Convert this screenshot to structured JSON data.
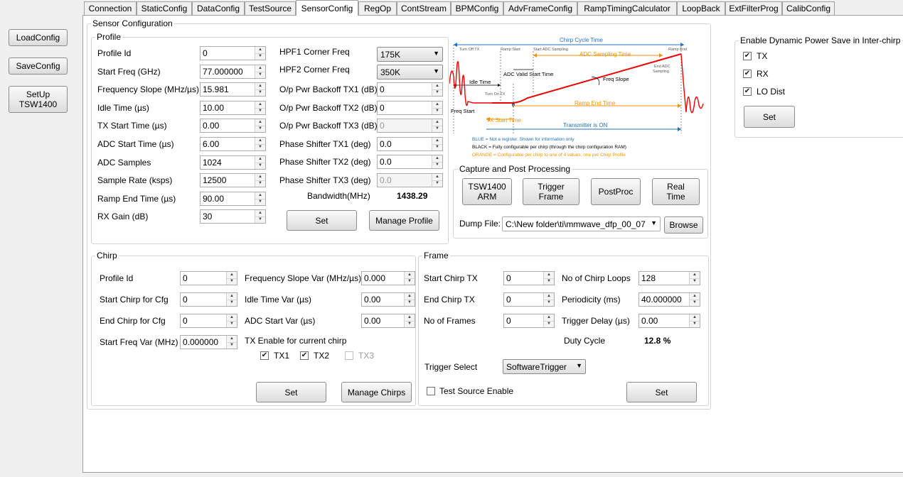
{
  "left_buttons": {
    "load": "LoadConfig",
    "save": "SaveConfig",
    "setup_line1": "SetUp",
    "setup_line2": "TSW1400"
  },
  "tabs": [
    "Connection",
    "StaticConfig",
    "DataConfig",
    "TestSource",
    "SensorConfig",
    "RegOp",
    "ContStream",
    "BPMConfig",
    "AdvFrameConfig",
    "RampTimingCalculator",
    "LoopBack",
    "ExtFilterProg",
    "CalibConfig"
  ],
  "active_tab": "SensorConfig",
  "sensor_title": "Sensor Configuration",
  "profile": {
    "title": "Profile",
    "fields": [
      {
        "label": "Profile Id",
        "value": "0"
      },
      {
        "label": "Start Freq (GHz)",
        "value": "77.000000"
      },
      {
        "label": "Frequency Slope (MHz/µs)",
        "value": "15.981"
      },
      {
        "label": "Idle Time (µs)",
        "value": "10.00"
      },
      {
        "label": "TX Start Time (µs)",
        "value": "0.00"
      },
      {
        "label": "ADC Start Time (µs)",
        "value": "6.00"
      },
      {
        "label": "ADC Samples",
        "value": "1024"
      },
      {
        "label": "Sample Rate (ksps)",
        "value": "12500"
      },
      {
        "label": "Ramp End Time (µs)",
        "value": "90.00"
      },
      {
        "label": "RX Gain (dB)",
        "value": "30"
      }
    ],
    "hpf1_label": "HPF1 Corner Freq",
    "hpf1_value": "175K",
    "hpf2_label": "HPF2 Corner Freq",
    "hpf2_value": "350K",
    "right_fields": [
      {
        "label": "O/p Pwr Backoff TX1 (dB)",
        "value": "0"
      },
      {
        "label": "O/p Pwr Backoff TX2 (dB)",
        "value": "0"
      },
      {
        "label": "O/p Pwr Backoff TX3 (dB)",
        "value": "0"
      },
      {
        "label": "Phase Shifter TX1 (deg)",
        "value": "0.0"
      },
      {
        "label": "Phase Shifter TX2 (deg)",
        "value": "0.0"
      },
      {
        "label": "Phase Shifter TX3 (deg)",
        "value": "0.0"
      }
    ],
    "bandwidth_label": "Bandwidth(MHz)",
    "bandwidth_value": "1438.29",
    "set": "Set",
    "manage": "Manage Profile"
  },
  "diagram": {
    "chirp_cycle": "Chirp Cycle Time",
    "turn_off_tx": "Turn Off TX",
    "ramp_start": "Ramp Start",
    "start_adc": "Start ADC Sampling",
    "ramp_end": "Ramp End",
    "adc_sampling_time": "ADC Sampling Time",
    "end_adc_1": "End ADC",
    "end_adc_2": "Sampling",
    "adc_valid": "ADC Valid Start Time",
    "freq_slope": "Freq Slope",
    "idle_time": "Idle Time",
    "turn_on_tx": "Turn On TX",
    "freq_start": "Freq Start",
    "zero": "0",
    "ramp_end_time": "Ramp End Time",
    "tx_start_time": "TX Start Time",
    "tx_on": "Transmitter is ON",
    "legend_blue": "BLUE = Not a register. Shown for information only",
    "legend_black": "BLACK = Fully configurable per chirp (through the chirp configuration RAM)",
    "legend_orange": "ORANGE = Configurable per chirp to one of 4 values, one per Chirp Profile"
  },
  "capture": {
    "title": "Capture and Post Processing",
    "tsw_line1": "TSW1400",
    "tsw_line2": "ARM",
    "trigger_line1": "Trigger",
    "trigger_line2": "Frame",
    "postproc": "PostProc",
    "realtime_line1": "Real",
    "realtime_line2": "Time",
    "dump_label": "Dump File:",
    "dump_value": "C:\\New folder\\ti\\mmwave_dfp_00_07",
    "browse": "Browse"
  },
  "dps": {
    "title": "Enable Dynamic Power Save in Inter-chirp",
    "options": [
      {
        "label": "TX",
        "checked": true
      },
      {
        "label": "RX",
        "checked": true
      },
      {
        "label": "LO Dist",
        "checked": true
      }
    ],
    "set": "Set"
  },
  "chirp": {
    "title": "Chirp",
    "left_fields": [
      {
        "label": "Profile Id",
        "value": "0"
      },
      {
        "label": "Start Chirp for Cfg",
        "value": "0"
      },
      {
        "label": "End Chirp for Cfg",
        "value": "0"
      },
      {
        "label": "Start Freq Var (MHz)",
        "value": "0.000000"
      }
    ],
    "right_fields": [
      {
        "label": "Frequency Slope Var (MHz/µs)",
        "value": "0.000"
      },
      {
        "label": "Idle Time Var (µs)",
        "value": "0.00"
      },
      {
        "label": "ADC Start Var (µs)",
        "value": "0.00"
      }
    ],
    "tx_enable_label": "TX Enable for current chirp",
    "tx": [
      {
        "label": "TX1",
        "checked": true
      },
      {
        "label": "TX2",
        "checked": true
      },
      {
        "label": "TX3",
        "checked": false
      }
    ],
    "set": "Set",
    "manage": "Manage Chirps"
  },
  "frame": {
    "title": "Frame",
    "left_fields": [
      {
        "label": "Start Chirp TX",
        "value": "0"
      },
      {
        "label": "End Chirp TX",
        "value": "0"
      },
      {
        "label": "No of Frames",
        "value": "0"
      }
    ],
    "right_fields": [
      {
        "label": "No of Chirp Loops",
        "value": "128"
      },
      {
        "label": "Periodicity (ms)",
        "value": "40.000000"
      },
      {
        "label": "Trigger Delay (µs)",
        "value": "0.00"
      }
    ],
    "duty_label": "Duty Cycle",
    "duty_value": "12.8 %",
    "trigger_label": "Trigger Select",
    "trigger_value": "SoftwareTrigger",
    "test_source_label": "Test Source Enable",
    "set": "Set"
  }
}
